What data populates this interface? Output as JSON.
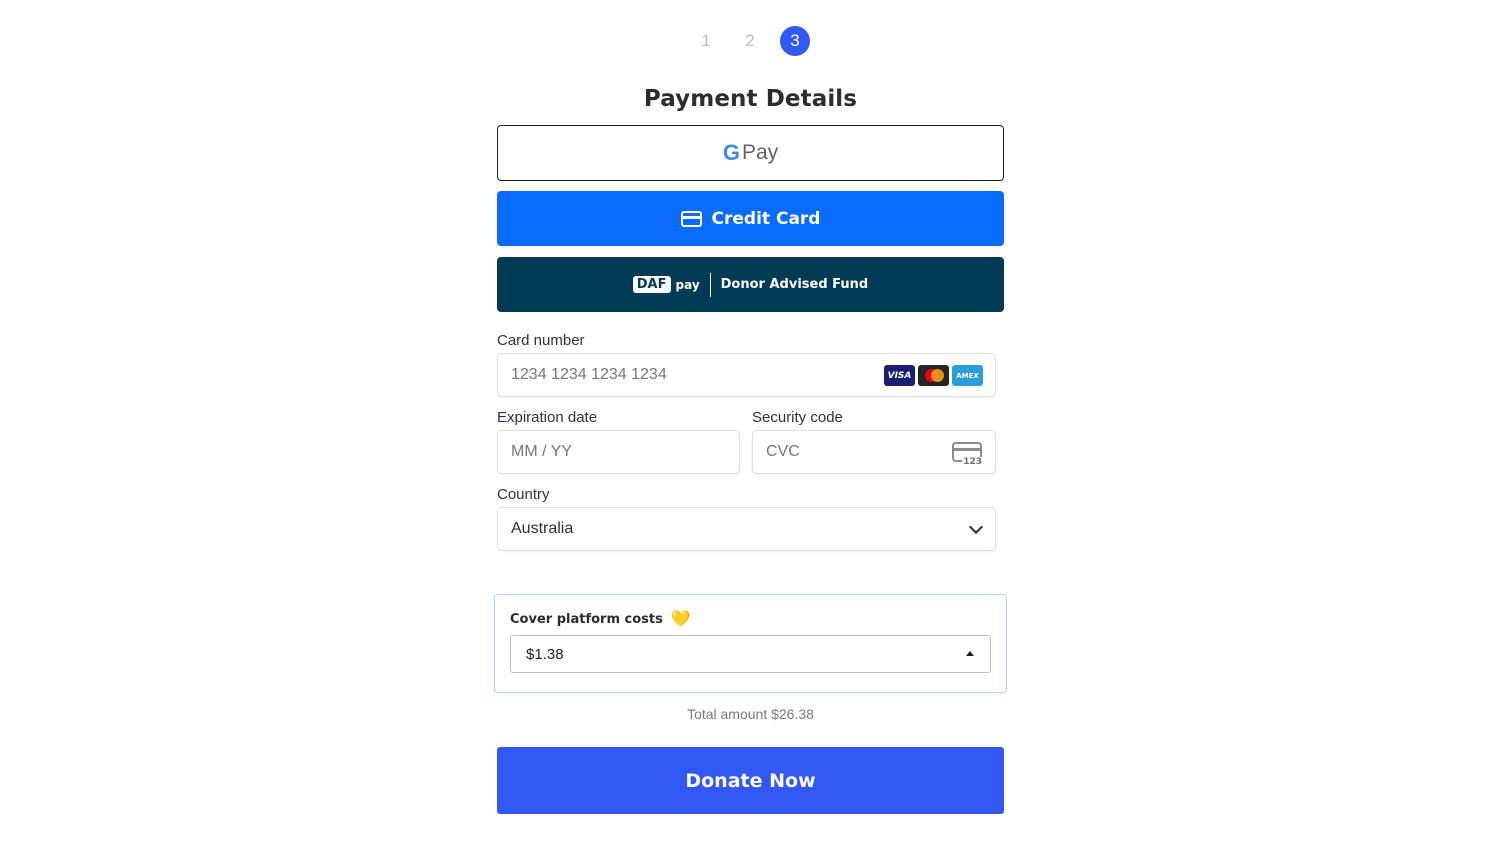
{
  "stepper": {
    "steps": [
      "1",
      "2",
      "3"
    ],
    "active_step": "3"
  },
  "page_title": "Payment Details",
  "payment_methods": {
    "gpay": {
      "logo_letter": "G",
      "label": "Pay"
    },
    "credit_card": {
      "label": "Credit Card"
    },
    "daf": {
      "badge": "DAF",
      "pay": "pay",
      "label": "Donor Advised Fund"
    }
  },
  "card_form": {
    "card_number": {
      "label": "Card number",
      "placeholder": "1234 1234 1234 1234",
      "brands": [
        "VISA",
        "Mastercard",
        "AMEX"
      ]
    },
    "expiration": {
      "label": "Expiration date",
      "placeholder": "MM / YY"
    },
    "security_code": {
      "label": "Security code",
      "placeholder": "CVC",
      "icon_text": "123"
    },
    "country": {
      "label": "Country",
      "value": "Australia"
    }
  },
  "cover_costs": {
    "title": "Cover platform costs",
    "heart": "💛",
    "selected": "$1.38"
  },
  "total": "Total amount $26.38",
  "donate_button": "Donate Now",
  "colors": {
    "accent": "#3158f5",
    "credit_card": "#0a6cff",
    "daf": "#003a55"
  }
}
